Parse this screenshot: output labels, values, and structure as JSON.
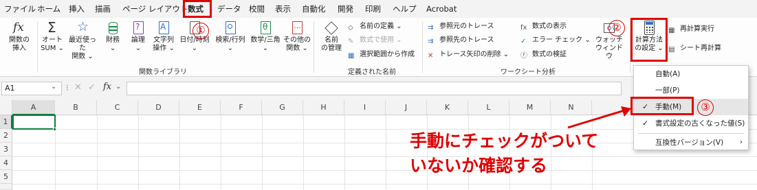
{
  "menu": {
    "tabs": [
      "ファイル",
      "ホーム",
      "挿入",
      "描画",
      "ページ レイアウト",
      "数式",
      "データ",
      "校閲",
      "表示",
      "自動化",
      "開発",
      "印刷",
      "ヘルプ",
      "Acrobat"
    ],
    "active": "数式"
  },
  "ribbon": {
    "function_library": {
      "insert_function": "関数の\n挿入",
      "autosum": "オート\nSUM ⌄",
      "recent": "最近使った\n関数 ⌄",
      "financial": "財務\n⌄",
      "logical": "論理\n⌄",
      "text": "文字列\n操作 ⌄",
      "datetime": "日付/時刻\n⌄",
      "lookup": "検索/行列\n⌄",
      "math": "数学/三角\n⌄",
      "more": "その他の\n関数 ⌄",
      "group_label": "関数ライブラリ"
    },
    "defined_names": {
      "name_manager": "名前\nの管理",
      "define_name": "名前の定義  ⌄",
      "use_in_formula": "数式で使用 ⌄",
      "create_from_selection": "選択範囲から作成",
      "group_label": "定義された名前"
    },
    "auditing": {
      "trace_precedents": "参照元のトレース",
      "trace_dependents": "参照先のトレース",
      "remove_arrows": "トレース矢印の削除  ⌄",
      "show_formulas": "数式の表示",
      "error_checking": "エラー チェック  ⌄",
      "evaluate_formula": "数式の検証",
      "watch_window": "ウォッチ\nウィンドウ",
      "group_label": "ワークシート分析"
    },
    "calculation": {
      "options": "計算方法\nの設定 ⌄",
      "calc_now": "再計算実行",
      "calc_sheet": "シート再計算"
    }
  },
  "formula_bar": {
    "name_box": "A1",
    "fx": "fx"
  },
  "grid": {
    "columns": [
      "A",
      "B",
      "C",
      "D",
      "E",
      "F",
      "G",
      "H",
      "I",
      "J",
      "K",
      "L",
      "M",
      "N"
    ],
    "rows": [
      "1",
      "2",
      "3",
      "4",
      "5"
    ]
  },
  "dropdown": {
    "items": [
      {
        "label": "自動(A)",
        "checked": false
      },
      {
        "label": "一部(P)",
        "checked": false
      },
      {
        "label": "手動(M)",
        "checked": true
      },
      {
        "label": "書式設定の古くなった値(S)",
        "checked": true
      },
      {
        "label": "互換性バージョン(V)",
        "checked": false,
        "submenu": true
      }
    ]
  },
  "annotations": {
    "step1": "①",
    "step2": "②",
    "step3": "③",
    "note_line1": "手動にチェックがついて",
    "note_line2": "いないか確認する"
  },
  "colors": {
    "highlight": "#e00000",
    "excel_green": "#107c41"
  }
}
